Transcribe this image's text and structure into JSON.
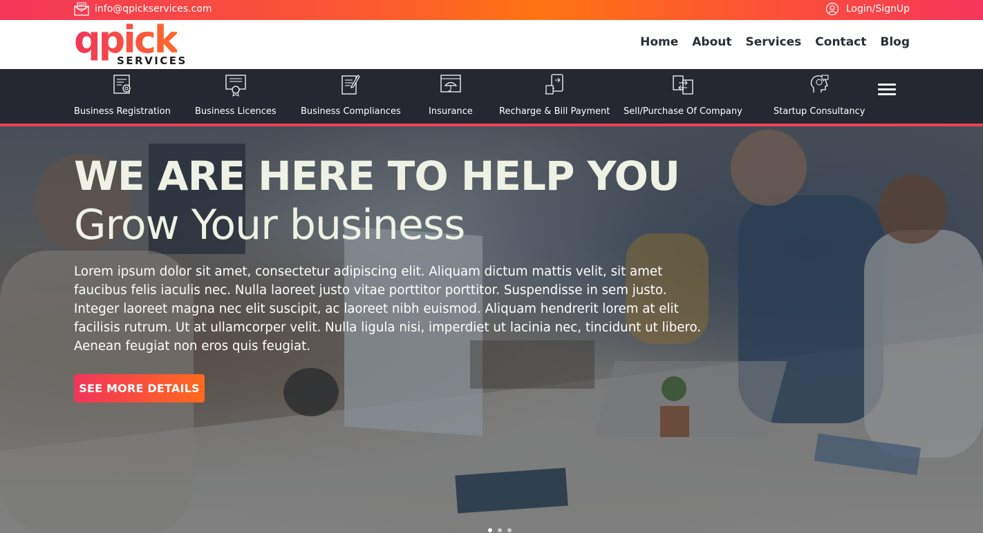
{
  "topbar": {
    "email": "info@qpickservices.com",
    "login": "Login/SignUp"
  },
  "logo": {
    "word": "qpick",
    "sub": "SERVICES"
  },
  "nav": [
    "Home",
    "About",
    "Services",
    "Contact",
    "Blog"
  ],
  "services": [
    {
      "label": "Business Registration",
      "icon": "registration-certificate-icon"
    },
    {
      "label": "Business Licences",
      "icon": "licence-certificate-icon"
    },
    {
      "label": "Business Compliances",
      "icon": "compliance-document-icon"
    },
    {
      "label": "Insurance",
      "icon": "insurance-umbrella-icon"
    },
    {
      "label": "Recharge & Bill Payment",
      "icon": "mobile-payment-icon"
    },
    {
      "label": "Sell/Purchase Of Company",
      "icon": "company-transfer-icon"
    },
    {
      "label": "Startup Consultancy",
      "icon": "consultancy-head-icon"
    }
  ],
  "hero": {
    "title_line1": "WE ARE HERE TO HELP YOU",
    "title_line2": "Grow Your business",
    "text": "Lorem ipsum dolor sit amet, consectetur adipiscing elit. Aliquam dictum mattis velit, sit amet faucibus felis iaculis nec. Nulla laoreet justo vitae porttitor porttitor. Suspendisse in sem justo. Integer laoreet magna nec elit suscipit, ac laoreet nibh euismod. Aliquam hendrerit lorem at elit facilisis rutrum. Ut at ullamcorper velit. Nulla ligula nisi, imperdiet ut lacinia nec, tincidunt ut libero. Aenean feugiat non eros quis feugiat.",
    "cta": "SEE MORE DETAILS"
  },
  "colors": {
    "brand_pink": "#f0355a",
    "brand_orange": "#ff7412",
    "service_bar_bg": "#252731"
  }
}
